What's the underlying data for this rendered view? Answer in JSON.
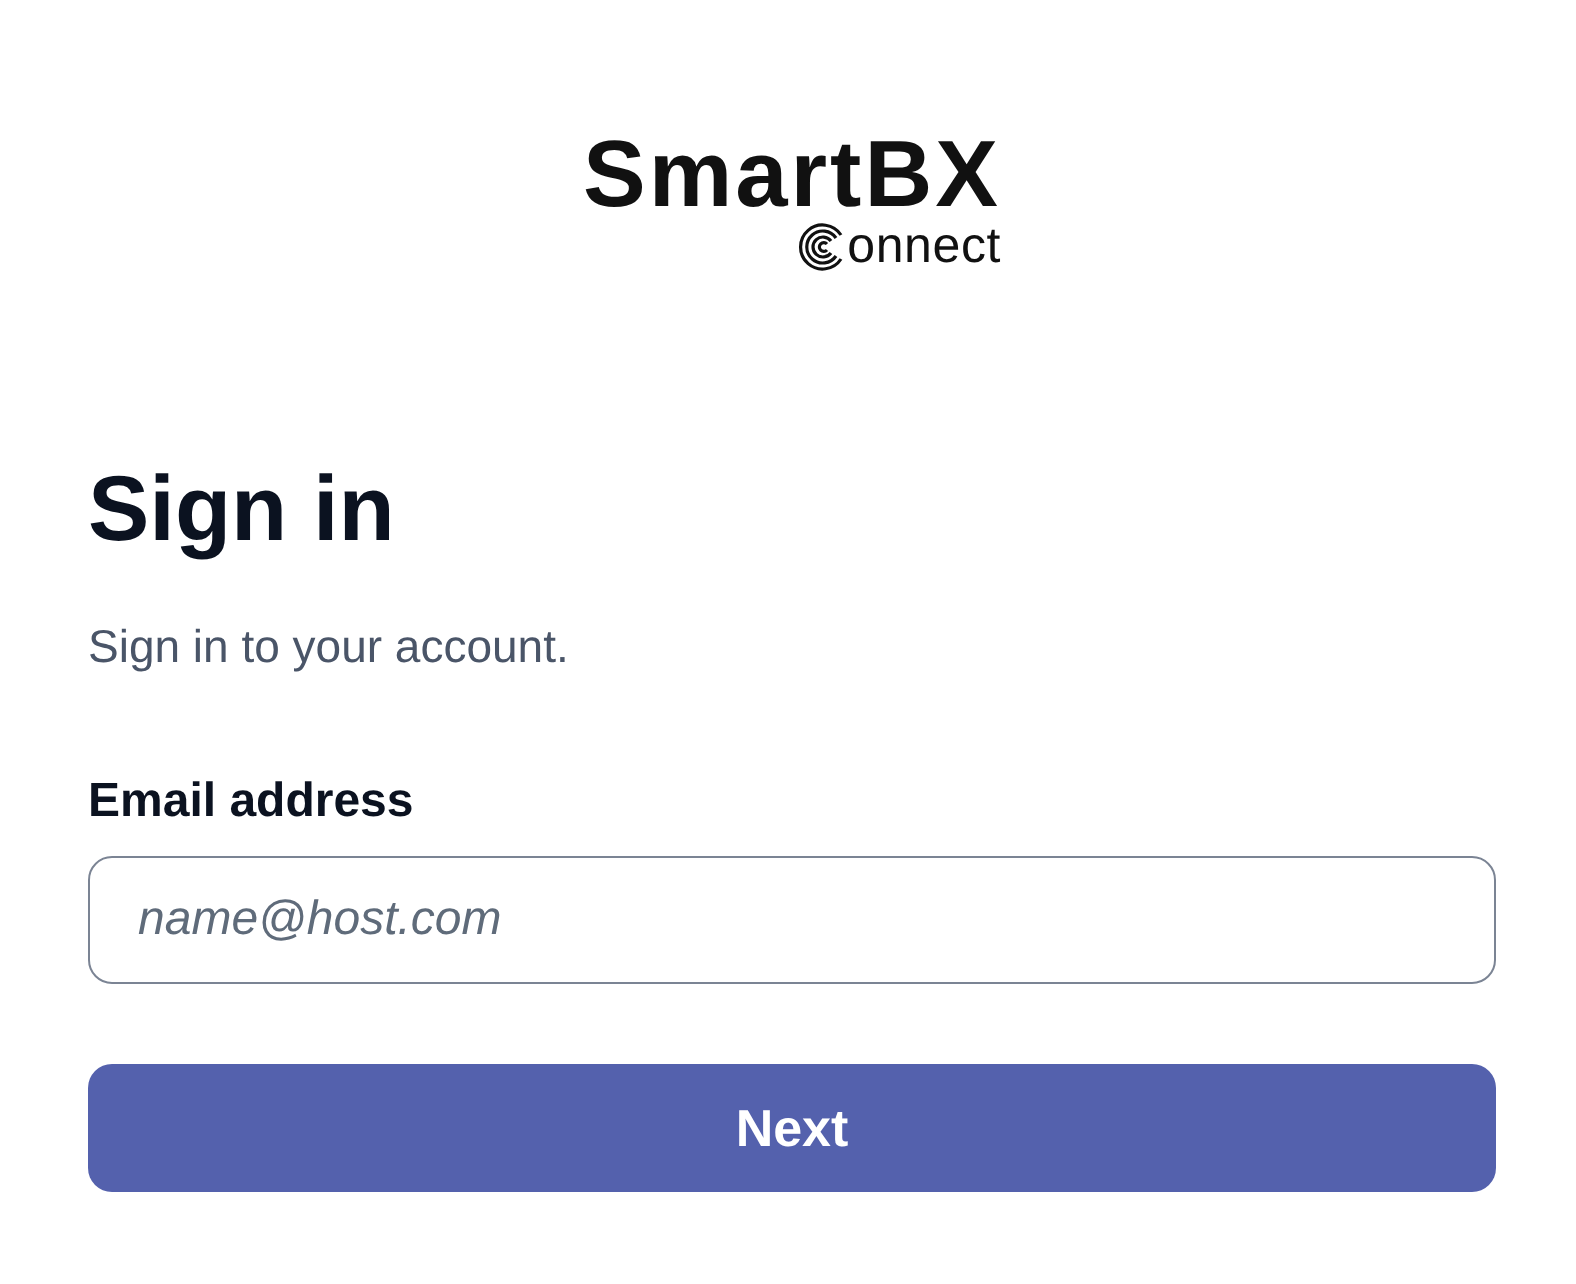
{
  "logo": {
    "title": "SmartBX",
    "subtitle": "onnect"
  },
  "heading": "Sign in",
  "description": "Sign in to your account.",
  "email_field": {
    "label": "Email address",
    "placeholder": "name@host.com"
  },
  "next_button": {
    "label": "Next"
  }
}
